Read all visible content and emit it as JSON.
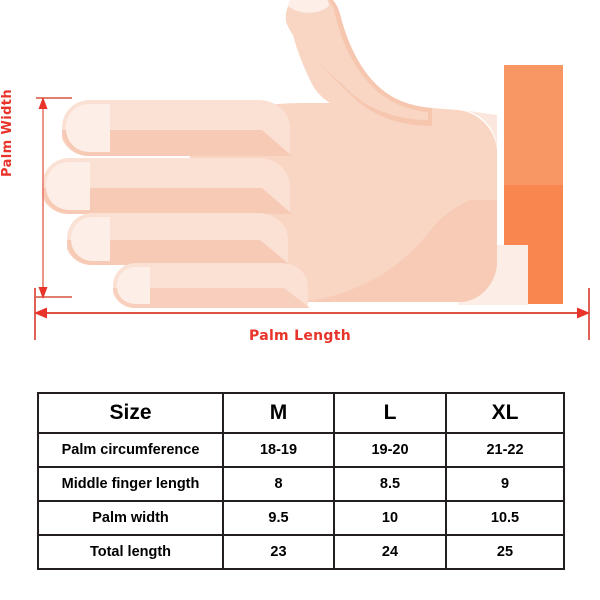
{
  "colors": {
    "dimension_red": "#E8342A",
    "dimension_line": "#D93A2B",
    "skin_light": "#FBE0D4",
    "skin_base": "#F9D5C3",
    "skin_shadow": "#F6C3AB",
    "nail": "#FDEFE8",
    "cuff_light": "#FBEAE2",
    "sleeve_top": "#F79761",
    "sleeve_bottom": "#F9854F",
    "table_border": "#231f20",
    "table_text": "#000000",
    "background": "#FFFFFF"
  },
  "illustration": {
    "name": "hand-measurement-diagram",
    "palm_width_label": "Palm Width",
    "palm_length_label": "Palm Length",
    "icons": {
      "hand": "hand-illustration",
      "sleeve": "sleeve-block",
      "width_arrow": "vertical-double-arrow-icon",
      "length_arrow": "horizontal-double-arrow-icon"
    }
  },
  "size_table": {
    "columns": [
      "Size",
      "M",
      "L",
      "XL"
    ],
    "rows": [
      {
        "label": "Palm circumference",
        "values": [
          "18-19",
          "19-20",
          "21-22"
        ]
      },
      {
        "label": "Middle finger length",
        "values": [
          "8",
          "8.5",
          "9"
        ]
      },
      {
        "label": "Palm width",
        "values": [
          "9.5",
          "10",
          "10.5"
        ]
      },
      {
        "label": "Total length",
        "values": [
          "23",
          "24",
          "25"
        ]
      }
    ]
  }
}
